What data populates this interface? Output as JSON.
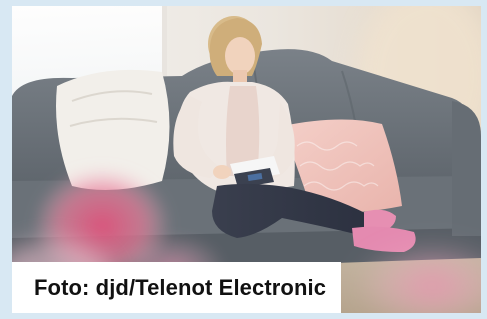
{
  "caption": {
    "text": "Foto: djd/Telenot Electronic"
  },
  "photo": {
    "subject": "photo-woman-on-sofa"
  },
  "colors": {
    "frame_background": "#d8e8f3",
    "caption_background": "#ffffff",
    "caption_text": "#111111",
    "sofa": "#6f767d",
    "wall": "#ece7e1"
  }
}
